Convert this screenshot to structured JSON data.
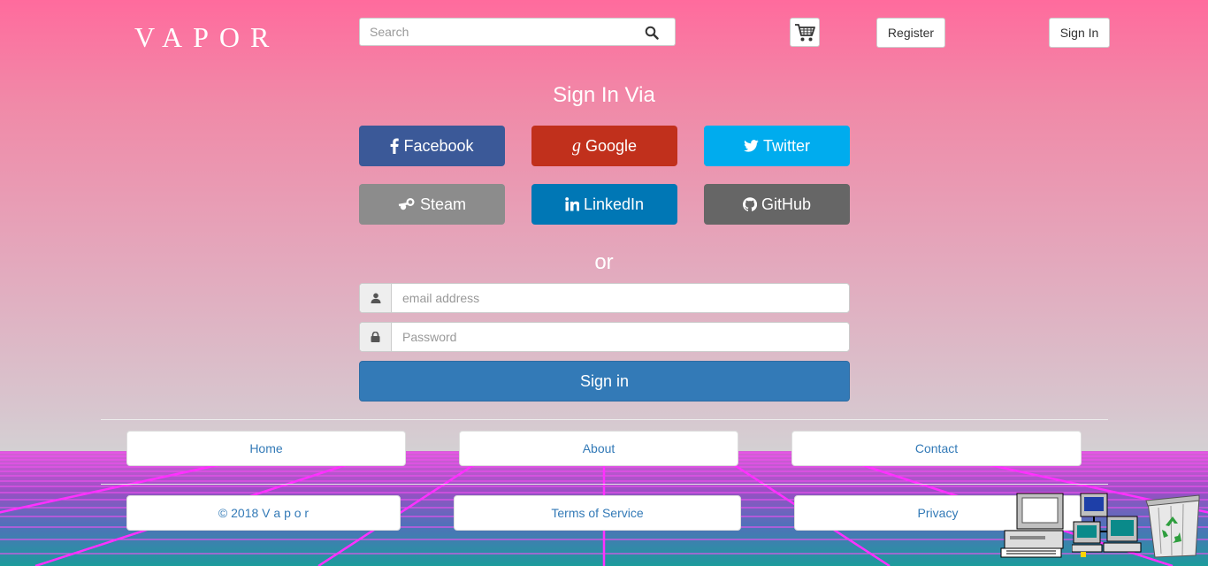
{
  "header": {
    "logo": "VAPOR",
    "search_placeholder": "Search",
    "register_label": "Register",
    "signin_label": "Sign In"
  },
  "signin": {
    "heading": "Sign In Via",
    "providers": [
      {
        "label": "Facebook",
        "icon": "facebook-icon",
        "color": "#3b5998"
      },
      {
        "label": "Google",
        "icon": "google-icon",
        "color": "#c1301c"
      },
      {
        "label": "Twitter",
        "icon": "twitter-icon",
        "color": "#00acee"
      },
      {
        "label": "Steam",
        "icon": "steam-icon",
        "color": "#8c8c8c"
      },
      {
        "label": "LinkedIn",
        "icon": "linkedin-icon",
        "color": "#0077b5"
      },
      {
        "label": "GitHub",
        "icon": "github-icon",
        "color": "#666666"
      }
    ],
    "or_text": "or",
    "email_placeholder": "email address",
    "password_placeholder": "Password",
    "submit_label": "Sign in"
  },
  "footer": {
    "home": "Home",
    "about": "About",
    "contact": "Contact",
    "copyright": "© 2018 V a p o r",
    "terms": "Terms of Service",
    "privacy": "Privacy"
  },
  "desktop_icons": [
    "computer-icon",
    "network-icon",
    "recycle-bin-icon"
  ],
  "colors": {
    "primary": "#337ab7",
    "background_top": "#ff6b9d",
    "grid_line": "#e040e0"
  }
}
